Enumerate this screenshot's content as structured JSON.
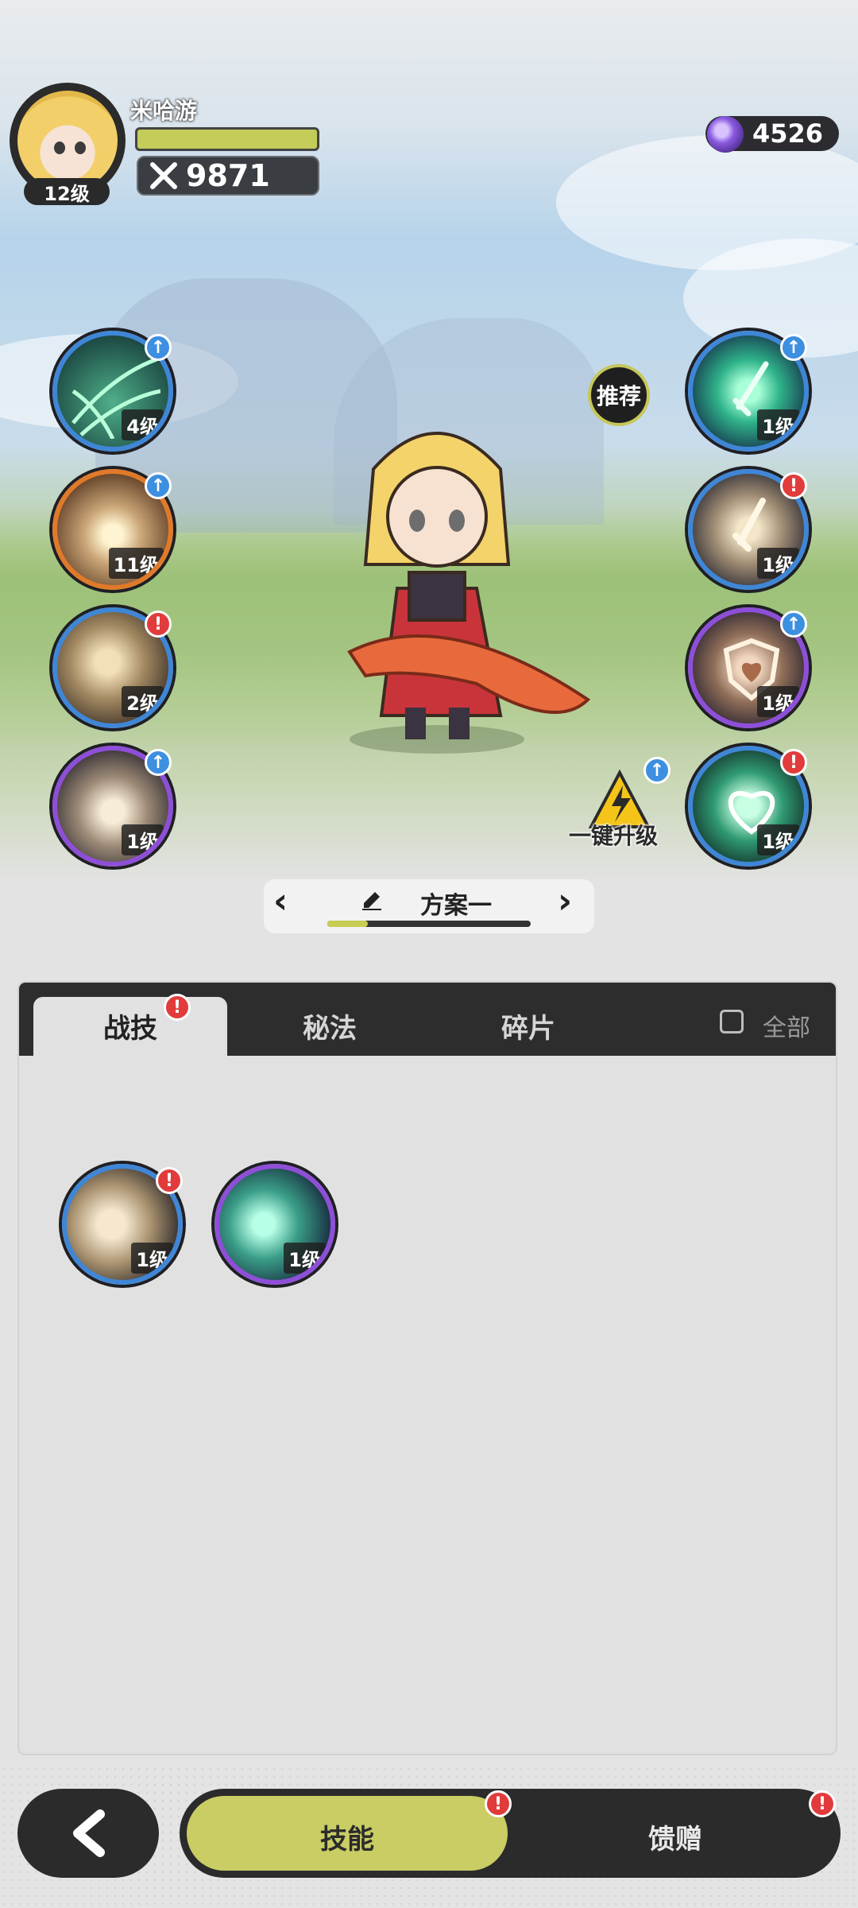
{
  "player": {
    "name": "米哈游",
    "level": "12级",
    "power": "9871",
    "exp_fraction": 1.0
  },
  "currency": {
    "amount": "4526",
    "icon": "purple-gem-icon"
  },
  "left_skills": [
    {
      "level": "4级",
      "icon": "web-slash-icon",
      "badge": "up"
    },
    {
      "level": "11级",
      "icon": "burst-icon",
      "badge": "up"
    },
    {
      "level": "2级",
      "icon": "leaping-strike-icon",
      "badge": "alert"
    },
    {
      "level": "1级",
      "icon": "claw-icon",
      "badge": "up"
    }
  ],
  "right_skills": [
    {
      "level": "1级",
      "icon": "green-sword-icon",
      "badge": "up"
    },
    {
      "level": "1级",
      "icon": "sword-upgrade-icon",
      "badge": "alert"
    },
    {
      "level": "1级",
      "icon": "heart-shield-icon",
      "badge": "up"
    },
    {
      "level": "1级",
      "icon": "heal-heart-icon",
      "badge": "alert"
    }
  ],
  "recommend_label": "推荐",
  "upgrade_all_label": "一键升级",
  "plan": {
    "label": "方案一",
    "progress": 0.2
  },
  "tabs": [
    {
      "label": "战技",
      "active": true,
      "alert": true
    },
    {
      "label": "秘法",
      "active": false,
      "alert": false
    },
    {
      "label": "碎片",
      "active": false,
      "alert": false
    }
  ],
  "filter_all_label": "全部",
  "inventory": [
    {
      "level": "1级",
      "icon": "skull-crescent-icon",
      "badge": "alert"
    },
    {
      "level": "1级",
      "icon": "teal-slash-icon",
      "badge": ""
    }
  ],
  "bottom_nav": [
    {
      "label": "技能",
      "active": true,
      "alert": true
    },
    {
      "label": "馈赠",
      "active": false,
      "alert": true
    }
  ],
  "colors": {
    "accent": "#c9cd63",
    "alert": "#e23b3b",
    "upgrade": "#3d8fe0",
    "dark": "#2b2b2b"
  }
}
